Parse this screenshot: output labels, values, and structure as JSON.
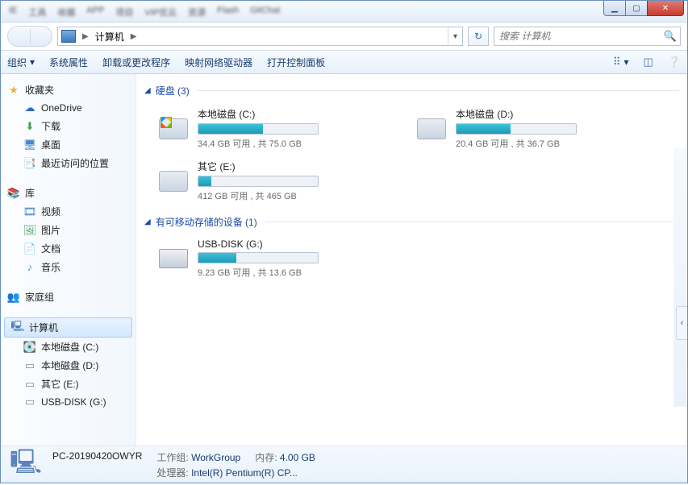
{
  "titlebar_blur": [
    "IE",
    "工具",
    "收据",
    "APP",
    "项目",
    "VIP优云",
    "资源",
    "Flash",
    "GitChat"
  ],
  "address": {
    "crumb_root": "计算机",
    "crumb_arrow": "▶"
  },
  "search": {
    "placeholder": "搜索 计算机"
  },
  "toolbar": {
    "organize": "组织",
    "props": "系统属性",
    "uninstall": "卸载或更改程序",
    "netdrv": "映射网络驱动器",
    "ctrlpanel": "打开控制面板"
  },
  "sidebar": {
    "favorites": "收藏夹",
    "onedrive": "OneDrive",
    "downloads": "下载",
    "desktop": "桌面",
    "recent": "最近访问的位置",
    "libraries": "库",
    "videos": "视频",
    "pictures": "图片",
    "docs": "文档",
    "music": "音乐",
    "homegroup": "家庭组",
    "computer": "计算机",
    "drive_c": "本地磁盘 (C:)",
    "drive_d": "本地磁盘 (D:)",
    "drive_e": "其它 (E:)",
    "drive_g": "USB-DISK (G:)"
  },
  "groups": {
    "hdd_label": "硬盘 (3)",
    "removable_label": "有可移动存储的设备 (1)"
  },
  "drives": {
    "c": {
      "name": "本地磁盘 (C:)",
      "stat": "34.4 GB 可用 , 共 75.0 GB",
      "pct": 54
    },
    "d": {
      "name": "本地磁盘 (D:)",
      "stat": "20.4 GB 可用 , 共 36.7 GB",
      "pct": 45
    },
    "e": {
      "name": "其它 (E:)",
      "stat": "412 GB 可用 , 共 465 GB",
      "pct": 11
    },
    "g": {
      "name": "USB-DISK (G:)",
      "stat": "9.23 GB 可用 , 共 13.6 GB",
      "pct": 32
    }
  },
  "details": {
    "hostname": "PC-20190420OWYR",
    "workgroup_lbl": "工作组:",
    "workgroup": "WorkGroup",
    "mem_lbl": "内存:",
    "mem": "4.00 GB",
    "cpu_lbl": "处理器:",
    "cpu": "Intel(R) Pentium(R) CP..."
  }
}
